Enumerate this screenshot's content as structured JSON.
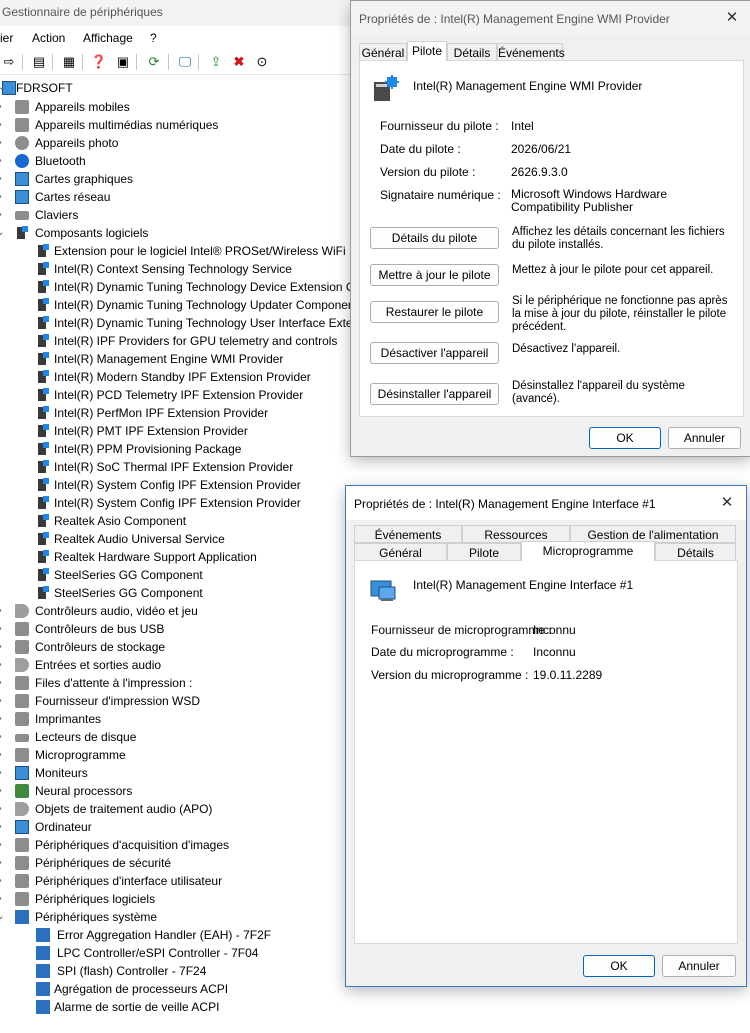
{
  "device_manager": {
    "title": "Gestionnaire de périphériques",
    "menu": [
      "ier",
      "Action",
      "Affichage",
      "?"
    ],
    "root": "FDRSOFT",
    "categories": [
      "Appareils mobiles",
      "Appareils multimédias numériques",
      "Appareils photo",
      "Bluetooth",
      "Cartes graphiques",
      "Cartes réseau",
      "Claviers",
      "Composants logiciels"
    ],
    "software_components": [
      "Extension pour le logiciel Intel® PROSet/Wireless WiFi",
      "Intel(R) Context Sensing Technology Service",
      "Intel(R) Dynamic Tuning Technology Device Extension C",
      "Intel(R) Dynamic Tuning Technology Updater Componen",
      "Intel(R) Dynamic Tuning Technology User Interface Exter",
      "Intel(R) IPF Providers for GPU telemetry and controls",
      "Intel(R) Management Engine WMI Provider",
      "Intel(R) Modern Standby IPF Extension Provider",
      "Intel(R) PCD Telemetry IPF Extension Provider",
      "Intel(R) PerfMon IPF Extension Provider",
      "Intel(R) PMT IPF Extension Provider",
      "Intel(R) PPM Provisioning Package",
      "Intel(R) SoC Thermal IPF Extension Provider",
      "Intel(R) System Config IPF Extension Provider",
      "Intel(R) System Config IPF Extension Provider",
      "Realtek Asio Component",
      "Realtek Audio Universal Service",
      "Realtek Hardware Support Application",
      "SteelSeries GG Component",
      "SteelSeries GG Component"
    ],
    "categories_after": [
      "Contrôleurs audio, vidéo et jeu",
      "Contrôleurs de bus USB",
      "Contrôleurs de stockage",
      "Entrées et sorties audio",
      "Files d'attente à l'impression :",
      "Fournisseur d'impression WSD",
      "Imprimantes",
      "Lecteurs de disque",
      "Microprogramme",
      "Moniteurs",
      "Neural processors",
      "Objets de traitement audio (APO)",
      "Ordinateur",
      "Périphériques d'acquisition d'images",
      "Périphériques de sécurité",
      "Périphériques d'interface utilisateur",
      "Périphériques logiciels",
      "Périphériques système"
    ],
    "system_devices": [
      "Error Aggregation Handler (EAH) - 7F2F",
      "LPC Controller/eSPI Controller - 7F04",
      "SPI (flash) Controller - 7F24",
      "Agrégation de processeurs ACPI",
      "Alarme de sortie de veille ACPI"
    ]
  },
  "driver_dialog": {
    "title": "Propriétés de : Intel(R) Management Engine WMI Provider",
    "close": "✕",
    "tabs": [
      "Général",
      "Pilote",
      "Détails",
      "Événements"
    ],
    "device_name": "Intel(R) Management Engine WMI Provider",
    "fields": [
      {
        "label": "Fournisseur du pilote :",
        "value": "Intel"
      },
      {
        "label": "Date du pilote :",
        "value": "2026/06/21"
      },
      {
        "label": "Version du pilote :",
        "value": "2626.9.3.0"
      },
      {
        "label": "Signataire numérique :",
        "value": "Microsoft Windows Hardware Compatibility Publisher"
      }
    ],
    "actions": [
      {
        "button": "Détails du pilote",
        "desc": "Affichez les détails concernant les fichiers du pilote installés."
      },
      {
        "button": "Mettre à jour le pilote",
        "desc": "Mettez à jour le pilote pour cet appareil."
      },
      {
        "button": "Restaurer le pilote",
        "desc": "Si le périphérique ne fonctionne pas après la mise à jour du pilote, réinstaller le pilote précédent."
      },
      {
        "button": "Désactiver l'appareil",
        "desc": "Désactivez l'appareil."
      },
      {
        "button": "Désinstaller l'appareil",
        "desc": "Désinstallez l'appareil du système (avancé)."
      }
    ],
    "ok": "OK",
    "cancel": "Annuler"
  },
  "firmware_dialog": {
    "title": "Propriétés de : Intel(R) Management Engine Interface #1",
    "close": "✕",
    "tabs_top": [
      "Événements",
      "Ressources",
      "Gestion de l'alimentation"
    ],
    "tabs_bottom": [
      "Général",
      "Pilote",
      "Microprogramme",
      "Détails"
    ],
    "device_name": "Intel(R) Management Engine Interface #1",
    "fields": [
      {
        "label": "Fournisseur de microprogramme :",
        "value": "Inconnu"
      },
      {
        "label": "Date du microprogramme :",
        "value": "Inconnu"
      },
      {
        "label": "Version du microprogramme :",
        "value": "19.0.11.2289"
      }
    ],
    "ok": "OK",
    "cancel": "Annuler"
  }
}
